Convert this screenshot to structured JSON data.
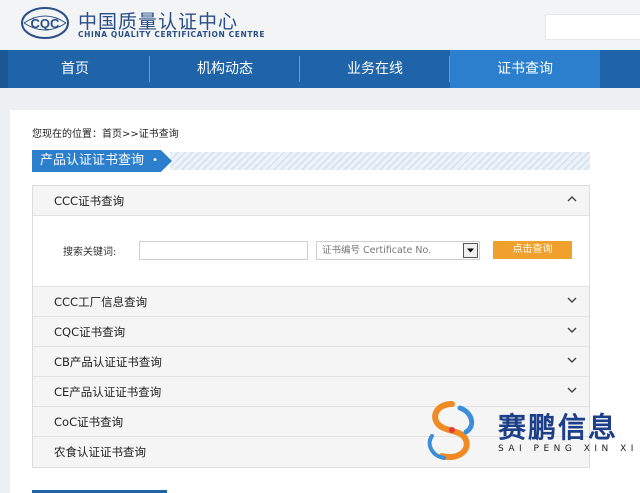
{
  "header": {
    "logo_text": "CQC",
    "title_cn": "中国质量认证中心",
    "title_en": "CHINA QUALITY CERTIFICATION CENTRE"
  },
  "nav": {
    "items": [
      {
        "label": "首页",
        "active": false
      },
      {
        "label": "机构动态",
        "active": false
      },
      {
        "label": "业务在线",
        "active": false
      },
      {
        "label": "证书查询",
        "active": true
      }
    ]
  },
  "breadcrumb": "您现在的位置：首页>>证书查询",
  "section_title": "产品认证证书查询",
  "section_marker": "•",
  "accordion": {
    "open_item": {
      "label": "CCC证书查询",
      "chevron": "up"
    },
    "search": {
      "keyword_label": "搜索关键词:",
      "keyword_value": "",
      "select_value": "证书编号 Certificate No.",
      "button_label": "点击查询"
    },
    "items": [
      {
        "label": "CCC工厂信息查询",
        "chevron": "down"
      },
      {
        "label": "CQC证书查询",
        "chevron": "down"
      },
      {
        "label": "CB产品认证证书查询",
        "chevron": "down"
      },
      {
        "label": "CE产品认证证书查询",
        "chevron": "down"
      },
      {
        "label": "CoC证书查询",
        "chevron": "down"
      },
      {
        "label": "农食认证证书查询",
        "chevron": "down"
      }
    ]
  },
  "watermark": {
    "name_cn": "赛鹏信息",
    "name_en": "SAI PENG XIN XI"
  },
  "colors": {
    "nav": "#1f63a8",
    "nav_active": "#2b7fcc",
    "button": "#f0a02d",
    "brand": "#2a4f86"
  }
}
